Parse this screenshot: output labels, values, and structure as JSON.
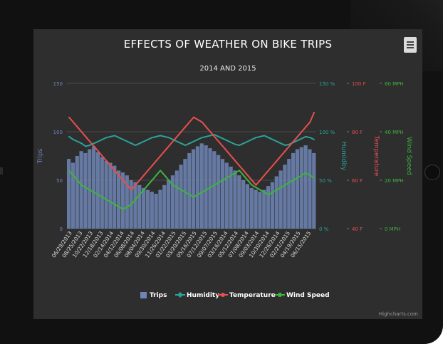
{
  "chart_data": {
    "type": "bar+line",
    "title": "EFFECTS OF WEATHER ON BIKE TRIPS",
    "subtitle": "2014 AND 2015",
    "credit": "Highcharts.com",
    "x_start": "06/29/2013",
    "x_end": "08/28/2015",
    "x_tick_labels": [
      "06/29/2013",
      "08/25/2013",
      "10/22/2013",
      "12/18/2013",
      "02/14/2014",
      "04/12/2014",
      "06/08/2014",
      "08/04/2014",
      "09/30/2014",
      "11/26/2014",
      "01/22/2015",
      "03/20/2015",
      "05/16/2015",
      "07/12/2015",
      "09/07/2015",
      "03/16/2014",
      "05/12/2014",
      "07/08/2014",
      "09/03/2014",
      "10/30/2014",
      "12/26/2014",
      "02/21/2015",
      "04/19/2015",
      "06/15/2015",
      "08/11/2015",
      "10/07/2015",
      "11/05/2015",
      "02/11/2015",
      "05/17/2015",
      "08/11/2015",
      "08/28/2015"
    ],
    "axes": {
      "trips": {
        "label": "Trips",
        "ticks": [
          "150",
          "100",
          "50",
          "0"
        ],
        "range": [
          0,
          150
        ],
        "color": "#6e86b6"
      },
      "humidity": {
        "label": "Humidity",
        "ticks": [
          "150 %",
          "100 %",
          "50 %",
          "0 %"
        ],
        "range": [
          0,
          150
        ],
        "color": "#2aa39a"
      },
      "temperature": {
        "label": "Temperature",
        "ticks": [
          "100 F",
          "80 F",
          "60 F",
          "40 F"
        ],
        "range": [
          40,
          100
        ],
        "color": "#e6504e"
      },
      "wind": {
        "label": "Wind Speed",
        "ticks": [
          "60 MPH",
          "40 MPH",
          "20 MPH",
          "0 MPH"
        ],
        "range": [
          0,
          60
        ],
        "color": "#3cb53c"
      }
    },
    "series": [
      {
        "name": "Trips",
        "type": "column",
        "color": "#6e86b6",
        "axis": "trips",
        "values": [
          72,
          68,
          75,
          80,
          78,
          82,
          85,
          79,
          74,
          70,
          68,
          65,
          60,
          58,
          55,
          50,
          48,
          45,
          42,
          40,
          38,
          36,
          40,
          45,
          50,
          55,
          60,
          66,
          72,
          78,
          82,
          85,
          88,
          86,
          83,
          80,
          76,
          72,
          68,
          64,
          60,
          55,
          50,
          46,
          42,
          40,
          38,
          40,
          44,
          48,
          54,
          60,
          66,
          72,
          78,
          82,
          84,
          86,
          82,
          78
        ]
      },
      {
        "name": "Humidity",
        "type": "line",
        "color": "#2aa39a",
        "axis": "humidity",
        "values": [
          95,
          92,
          90,
          88,
          85,
          86,
          88,
          90,
          92,
          94,
          95,
          96,
          94,
          92,
          90,
          88,
          86,
          88,
          90,
          92,
          94,
          95,
          96,
          95,
          94,
          92,
          90,
          88,
          86,
          88,
          90,
          92,
          94,
          95,
          96,
          97,
          95,
          93,
          91,
          89,
          87,
          86,
          88,
          90,
          92,
          94,
          95,
          96,
          94,
          92,
          90,
          88,
          86,
          87,
          89,
          91,
          93,
          95,
          94,
          92
        ]
      },
      {
        "name": "Temperature",
        "type": "line",
        "color": "#e6504e",
        "axis": "temperature",
        "values": [
          86,
          84,
          82,
          80,
          78,
          76,
          74,
          72,
          70,
          68,
          66,
          64,
          62,
          60,
          58,
          56,
          58,
          60,
          62,
          64,
          66,
          68,
          70,
          72,
          74,
          76,
          78,
          80,
          82,
          84,
          86,
          85,
          84,
          82,
          80,
          78,
          76,
          74,
          72,
          70,
          68,
          66,
          64,
          62,
          60,
          58,
          60,
          62,
          64,
          66,
          68,
          70,
          72,
          74,
          76,
          78,
          80,
          82,
          84,
          88
        ]
      },
      {
        "name": "Wind Speed",
        "type": "line",
        "color": "#3cb53c",
        "axis": "wind",
        "values": [
          24,
          22,
          20,
          18,
          17,
          16,
          15,
          14,
          13,
          12,
          11,
          10,
          9,
          8,
          9,
          10,
          12,
          14,
          16,
          18,
          20,
          22,
          24,
          22,
          20,
          18,
          17,
          16,
          15,
          14,
          13,
          14,
          15,
          16,
          17,
          18,
          19,
          20,
          21,
          22,
          23,
          24,
          22,
          20,
          18,
          17,
          16,
          15,
          14,
          15,
          16,
          17,
          18,
          19,
          20,
          21,
          22,
          23,
          22,
          21
        ]
      }
    ],
    "legend": [
      {
        "label": "Trips",
        "color": "#6e86b6",
        "marker": "square"
      },
      {
        "label": "Humidity",
        "color": "#2aa39a",
        "marker": "diamond"
      },
      {
        "label": "Temperature",
        "color": "#e6504e",
        "marker": "circle"
      },
      {
        "label": "Wind Speed",
        "color": "#3cb53c",
        "marker": "circle"
      }
    ],
    "legend_position": "bottom-center",
    "grid": true
  },
  "menu": {
    "icon": "hamburger-icon"
  }
}
